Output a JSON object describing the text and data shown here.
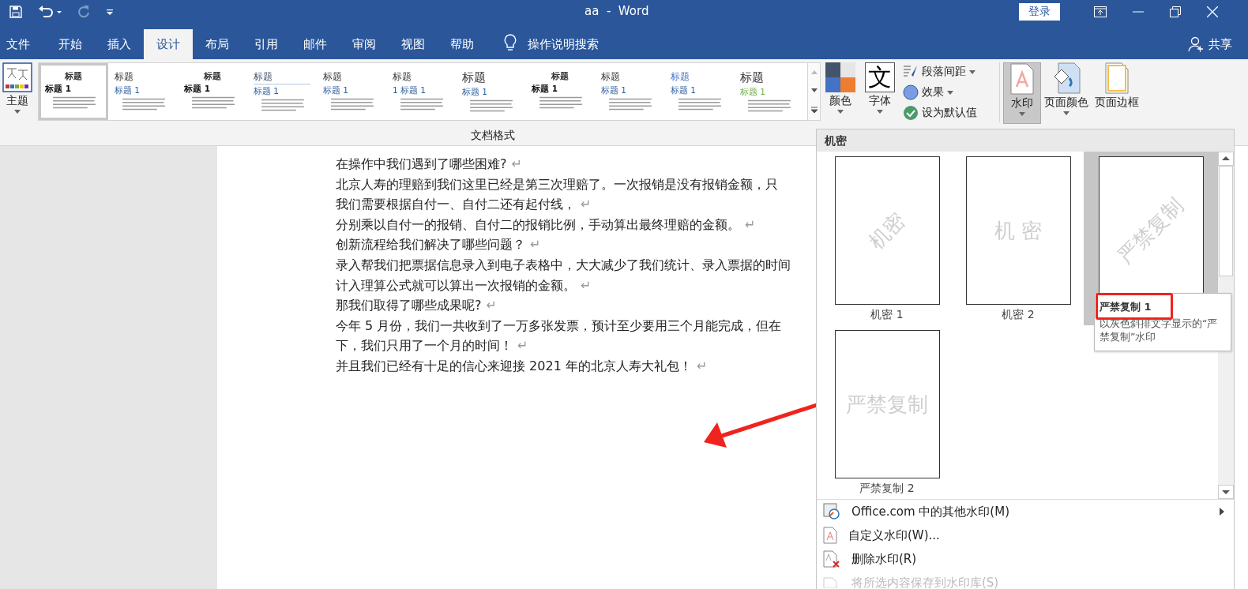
{
  "window": {
    "title": "aa  -  Word",
    "sign_in": "登录"
  },
  "tabs": [
    {
      "label": "文件",
      "selected": false
    },
    {
      "label": "开始",
      "selected": false
    },
    {
      "label": "插入",
      "selected": false
    },
    {
      "label": "设计",
      "selected": true
    },
    {
      "label": "布局",
      "selected": false
    },
    {
      "label": "引用",
      "selected": false
    },
    {
      "label": "邮件",
      "selected": false
    },
    {
      "label": "审阅",
      "selected": false
    },
    {
      "label": "视图",
      "selected": false
    },
    {
      "label": "帮助",
      "selected": false
    }
  ],
  "tell_me": "操作说明搜索",
  "share": "共享",
  "ribbon": {
    "themes": "主题",
    "style_sets": [
      {
        "title": "标题",
        "heading": "标题 1",
        "kind": "center-small",
        "selected": true
      },
      {
        "title": "标题",
        "heading": "标题 1",
        "kind": "left",
        "selected": false
      },
      {
        "title": "标题",
        "heading": "标题 1",
        "kind": "center-small",
        "selected": false
      },
      {
        "title": "标题",
        "heading": "标题 1",
        "kind": "underlined",
        "selected": false
      },
      {
        "title": "标题",
        "heading": "标题 1",
        "kind": "left",
        "selected": false
      },
      {
        "title": "标题",
        "heading": "1 标题 1",
        "kind": "left",
        "selected": false
      },
      {
        "title": "标题",
        "heading": "标题 1",
        "kind": "large",
        "selected": false
      },
      {
        "title": "标题",
        "heading": "标题 1",
        "kind": "center-small",
        "selected": false
      },
      {
        "title": "标题",
        "heading": "标题 1",
        "kind": "left",
        "selected": false
      },
      {
        "title": "标题",
        "heading": "标题 1",
        "kind": "blue",
        "selected": false
      },
      {
        "title": "标题",
        "heading": "标题 1",
        "kind": "large",
        "selected": false
      }
    ],
    "colors": "颜色",
    "fonts": {
      "label": "字体",
      "glyph": "文"
    },
    "small_buttons": [
      {
        "label": "段落间距",
        "kind": "spacing",
        "dropdown": true
      },
      {
        "label": "效果",
        "kind": "effects",
        "dropdown": true
      },
      {
        "label": "设为默认值",
        "kind": "default",
        "dropdown": false
      }
    ],
    "page_background": [
      {
        "label": "水印",
        "kind": "watermark",
        "selected": true,
        "dropdown": true
      },
      {
        "label": "页面颜色",
        "kind": "page-color",
        "selected": false,
        "dropdown": true
      },
      {
        "label": "页面边框",
        "kind": "page-borders",
        "selected": false,
        "dropdown": false
      }
    ],
    "group_label": "文档格式"
  },
  "document": {
    "lines": [
      {
        "text": "在操作中我们遇到了哪些困难?",
        "mark": "↵"
      },
      {
        "text": "北京人寿的理赔到我们这里已经是第三次理赔了。一次报销是没有报销金额，只"
      },
      {
        "text": "我们需要根据自付一、自付二还有起付线，",
        "mark": "↵"
      },
      {
        "text": "分别乘以自付一的报销、自付二的报销比例，手动算出最终理赔的金额。",
        "mark": "↵"
      },
      {
        "text": "创新流程给我们解决了哪些问题？",
        "mark": "↵"
      },
      {
        "text": "录入帮我们把票据信息录入到电子表格中，大大减少了我们统计、录入票据的时间"
      },
      {
        "text": "计入理算公式就可以算出一次报销的金额。",
        "mark": "↵"
      },
      {
        "text": "那我们取得了哪些成果呢?",
        "mark": "↵"
      },
      {
        "text": "今年  5  月份，我们一共收到了一万多张发票，预计至少要用三个月能完成，但在"
      },
      {
        "text": "下，我们只用了一个月的时间！",
        "mark": "↵"
      },
      {
        "text": "并且我们已经有十足的信心来迎接 2021 年的北京人寿大礼包！",
        "mark": "↵"
      }
    ]
  },
  "watermark_menu": {
    "section": "机密",
    "items": [
      {
        "label": "机密 1",
        "preview": "机密",
        "diagonal": true,
        "selected": false
      },
      {
        "label": "机密 2",
        "preview": "机 密",
        "diagonal": false,
        "selected": false
      },
      {
        "preview": "严禁复制",
        "diagonal": true,
        "selected": true
      },
      {
        "label": "严禁复制 2",
        "preview": "严禁复制",
        "diagonal": false,
        "selected": false
      }
    ],
    "tooltip": {
      "title": "严禁复制 1",
      "text": "以灰色斜排文字显示的“严禁复制”水印"
    },
    "commands": [
      {
        "label": "Office.com 中的其他水印(M)",
        "kind": "online",
        "submenu": true,
        "disabled": false
      },
      {
        "label": "自定义水印(W)...",
        "kind": "custom",
        "submenu": false,
        "disabled": false
      },
      {
        "label": "删除水印(R)",
        "kind": "remove",
        "submenu": false,
        "disabled": false
      },
      {
        "label": "将所选内容保存到水印库(S)",
        "kind": "save",
        "submenu": false,
        "disabled": true
      }
    ]
  }
}
